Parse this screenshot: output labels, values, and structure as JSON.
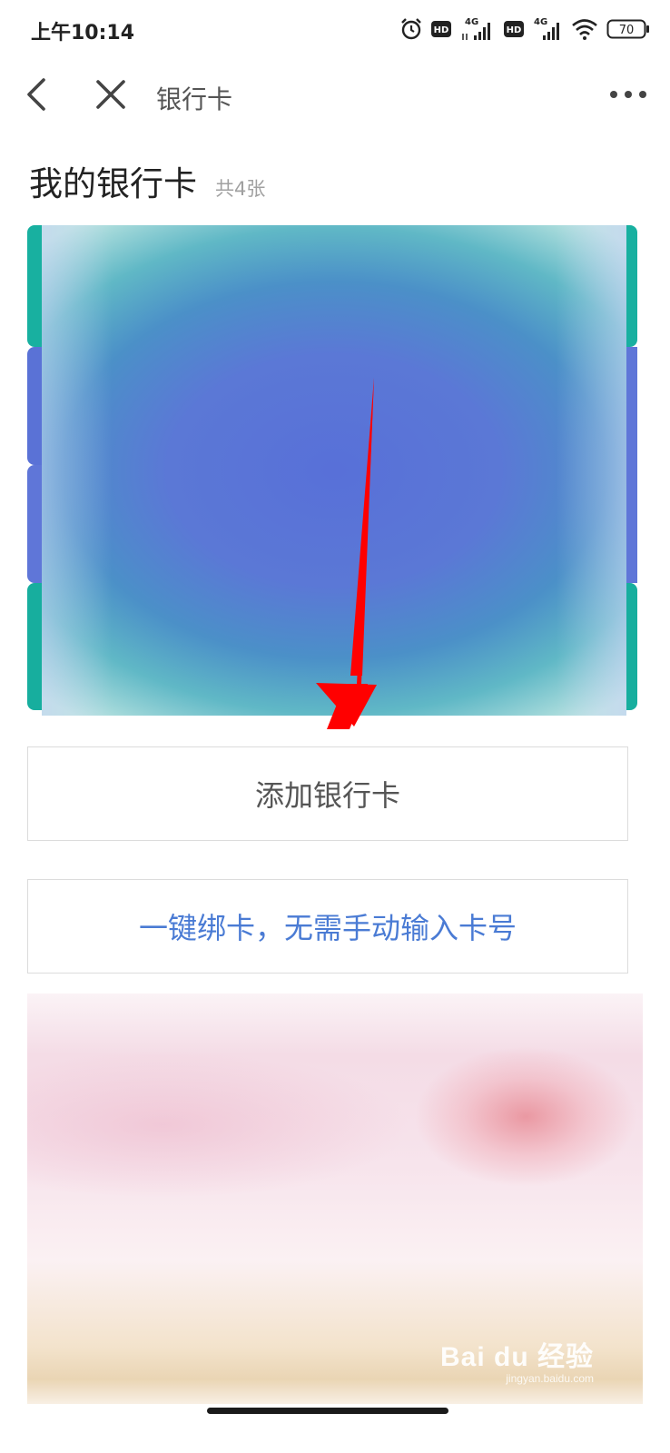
{
  "status_bar": {
    "time": "上午10:14",
    "network_1": "4G",
    "network_2": "4G",
    "hd_badge": "HD",
    "battery": "70"
  },
  "nav": {
    "title": "银行卡",
    "icons": [
      "chevron-left-icon",
      "close-icon",
      "more-icon"
    ]
  },
  "page": {
    "title": "我的银行卡",
    "count": "共4张"
  },
  "buttons": {
    "add_card": "添加银行卡",
    "one_key_bind": "一键绑卡，无需手动输入卡号"
  },
  "watermark": {
    "logo": "Bai du 经验",
    "sub": "jingyan.baidu.com"
  },
  "colors": {
    "link_blue": "#4a7bd4",
    "annotation_red": "#ff0000",
    "card_blue": "#5870d8",
    "card_teal": "#19b6a4"
  }
}
